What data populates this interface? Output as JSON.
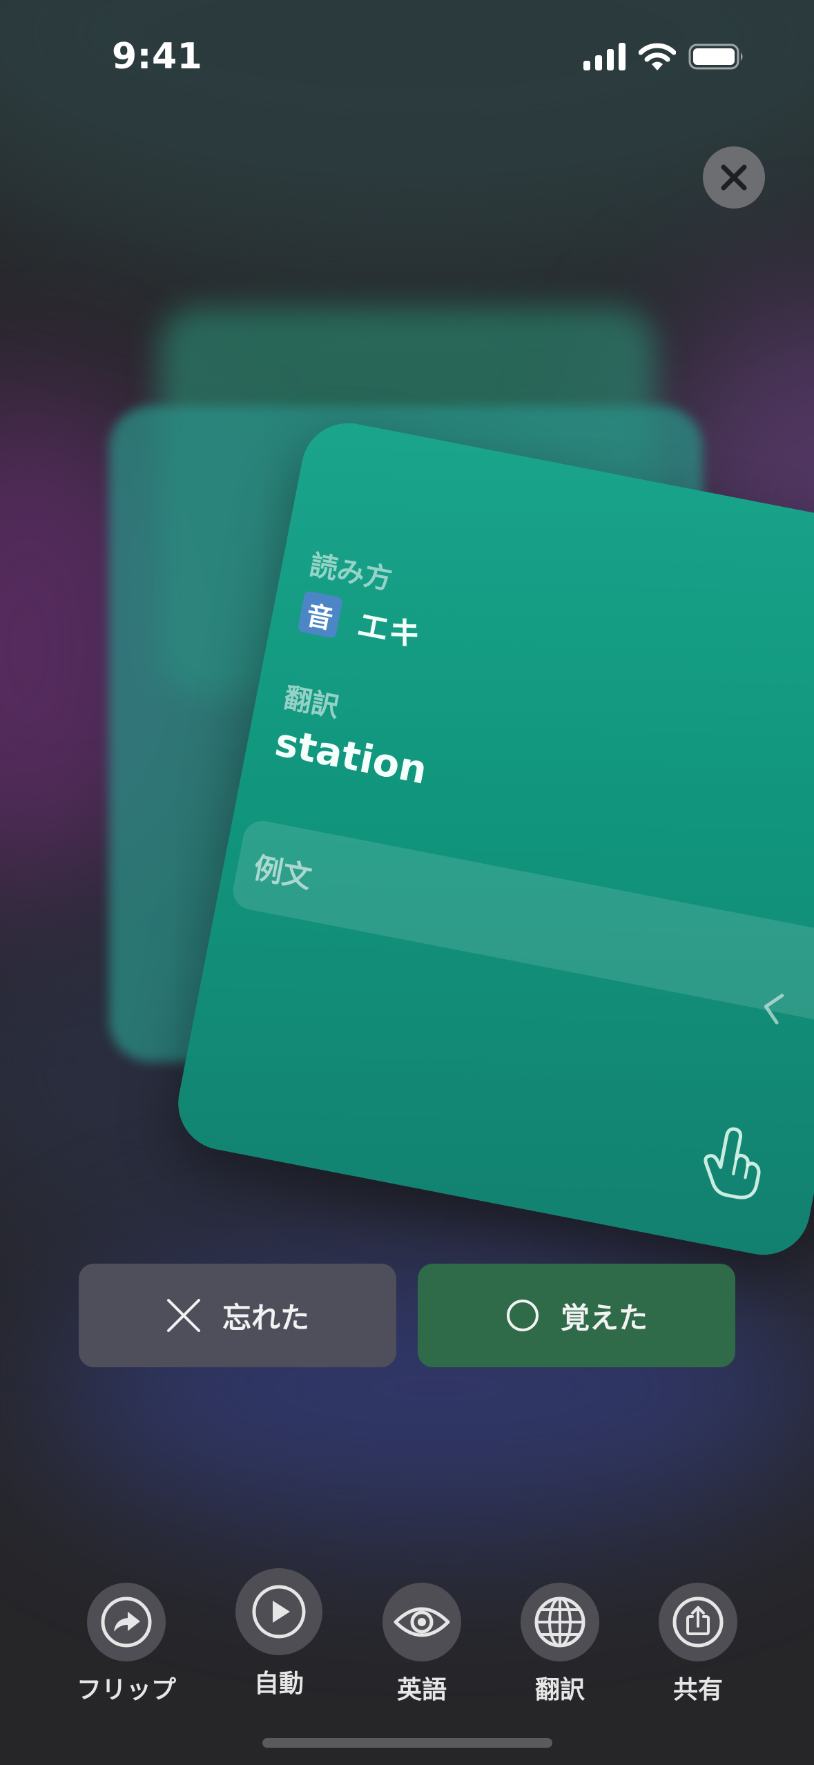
{
  "status_bar": {
    "time": "9:41"
  },
  "card": {
    "reading_label": "読み方",
    "onyomi_badge": "音",
    "reading_value": "エキ",
    "translation_label": "翻訳",
    "translation_value": "station",
    "example_label": "例文"
  },
  "actions": {
    "forgot_label": "忘れた",
    "remembered_label": "覚えた"
  },
  "toolbar": {
    "items": [
      {
        "label": "フリップ",
        "icon": "flip-icon"
      },
      {
        "label": "自動",
        "icon": "play-icon"
      },
      {
        "label": "英語",
        "icon": "eye-icon"
      },
      {
        "label": "翻訳",
        "icon": "globe-icon"
      },
      {
        "label": "共有",
        "icon": "share-icon"
      }
    ]
  },
  "colors": {
    "card": "#13977f",
    "forgot_button": "#4f4f5b",
    "remembered_button": "#2f6a49",
    "onyomi_badge": "#4d86c6"
  }
}
